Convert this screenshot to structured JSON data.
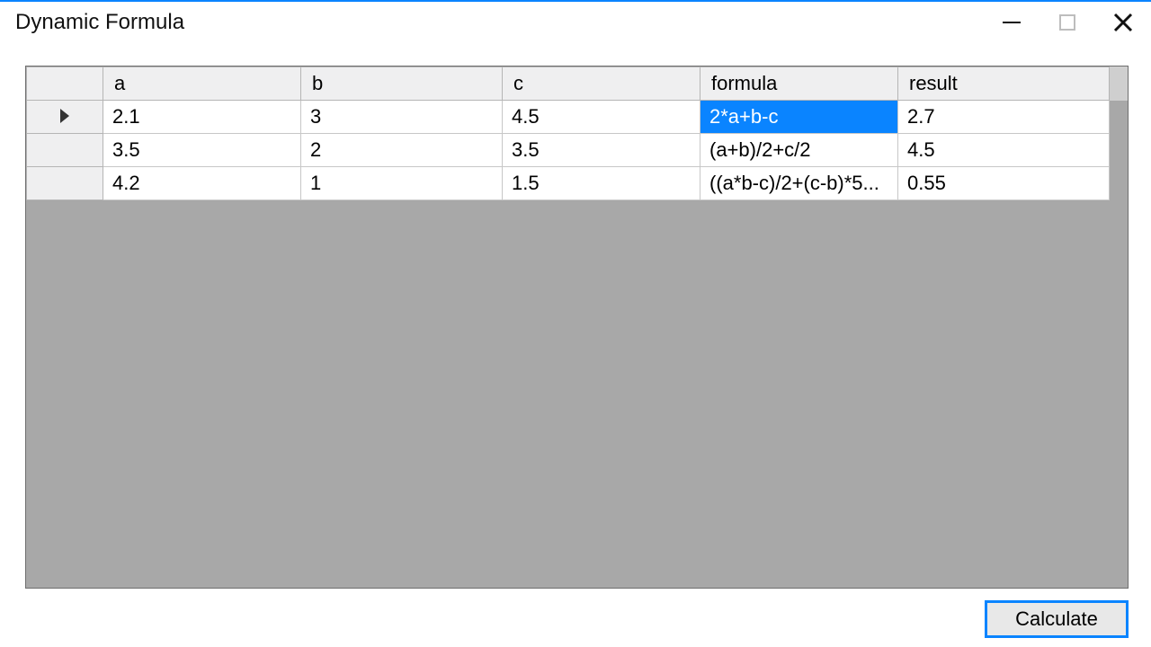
{
  "window": {
    "title": "Dynamic Formula"
  },
  "grid": {
    "columns": {
      "a": "a",
      "b": "b",
      "c": "c",
      "formula": "formula",
      "result": "result"
    },
    "rows": [
      {
        "a": "2.1",
        "b": "3",
        "c": "4.5",
        "formula": "2*a+b-c",
        "result": "2.7",
        "current": true,
        "selected_col": "formula"
      },
      {
        "a": "3.5",
        "b": "2",
        "c": "3.5",
        "formula": "(a+b)/2+c/2",
        "result": "4.5",
        "current": false
      },
      {
        "a": "4.2",
        "b": "1",
        "c": "1.5",
        "formula": "((a*b-c)/2+(c-b)*5...",
        "result": "0.55",
        "current": false
      }
    ]
  },
  "buttons": {
    "calculate": "Calculate"
  }
}
